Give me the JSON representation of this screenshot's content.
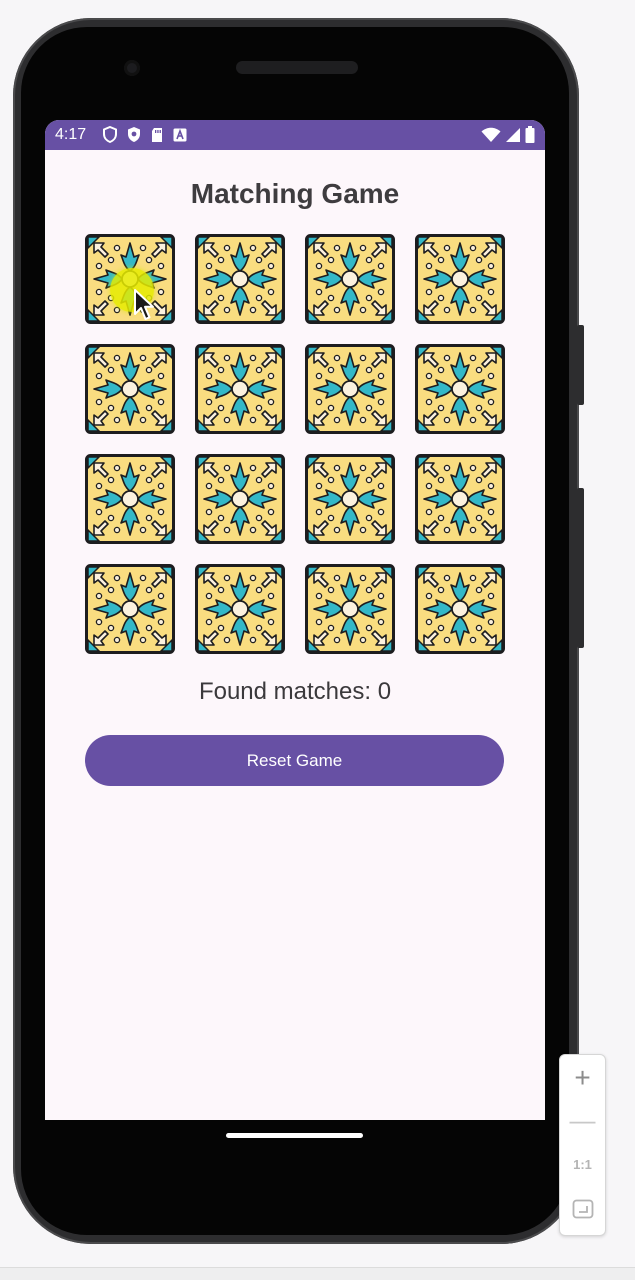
{
  "status_bar": {
    "time": "4:17",
    "color": "#6750a4"
  },
  "app": {
    "title": "Matching Game",
    "found_matches_text": "Found matches: 0",
    "reset_label": "Reset Game",
    "accent_color": "#6750a4",
    "background_color": "#fdf7fb"
  },
  "cards": [
    {
      "state": "face-down",
      "icon": "tile-pattern-icon"
    },
    {
      "state": "face-down",
      "icon": "tile-pattern-icon"
    },
    {
      "state": "face-down",
      "icon": "tile-pattern-icon"
    },
    {
      "state": "face-down",
      "icon": "tile-pattern-icon"
    },
    {
      "state": "face-down",
      "icon": "tile-pattern-icon"
    },
    {
      "state": "face-down",
      "icon": "tile-pattern-icon"
    },
    {
      "state": "face-down",
      "icon": "tile-pattern-icon"
    },
    {
      "state": "face-down",
      "icon": "tile-pattern-icon"
    },
    {
      "state": "face-down",
      "icon": "tile-pattern-icon"
    },
    {
      "state": "face-down",
      "icon": "tile-pattern-icon"
    },
    {
      "state": "face-down",
      "icon": "tile-pattern-icon"
    },
    {
      "state": "face-down",
      "icon": "tile-pattern-icon"
    },
    {
      "state": "face-down",
      "icon": "tile-pattern-icon"
    },
    {
      "state": "face-down",
      "icon": "tile-pattern-icon"
    },
    {
      "state": "face-down",
      "icon": "tile-pattern-icon"
    },
    {
      "state": "face-down",
      "icon": "tile-pattern-icon"
    }
  ],
  "tile_colors": {
    "border": "#1d1d1f",
    "background": "#f9dd80",
    "teal": "#33b8c8",
    "cream": "#fbf1de"
  },
  "zoom_panel": {
    "plus": "+",
    "minus": "—",
    "ratio": "1:1"
  }
}
